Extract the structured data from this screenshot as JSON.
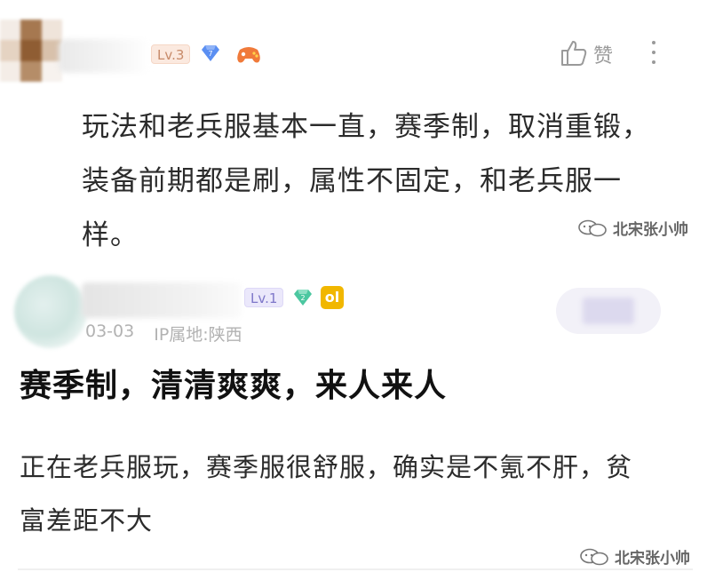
{
  "comment1": {
    "level": "Lv.3",
    "diamond_level": "7",
    "text": "玩法和老兵服基本一直，赛季制，取消重锻，装备前期都是刷，属性不固定，和老兵服一样。",
    "like_label": "赞"
  },
  "watermark": {
    "text": "北宋张小帅"
  },
  "comment2": {
    "level": "Lv.1",
    "diamond_level": "2",
    "badge_symbol": "ol",
    "date": "03-03",
    "ip_location": "IP属地:陕西",
    "title": "赛季制，清清爽爽，来人来人",
    "text": "正在老兵服玩，赛季服很舒服，确实是不氪不肝，贫富差距不大"
  },
  "colors": {
    "lv3_text": "#c78a69",
    "lv1_text": "#7e77c9",
    "diamond_blue": "#5b8ff2",
    "diamond_green": "#4cc7a0",
    "gold_badge": "#f1b700",
    "orange_badge": "#f07a3a"
  },
  "icons": [
    "thumbs-up-icon",
    "more-vertical-icon",
    "diamond-icon",
    "game-controller-icon",
    "wechat-icon",
    "leo-icon"
  ]
}
